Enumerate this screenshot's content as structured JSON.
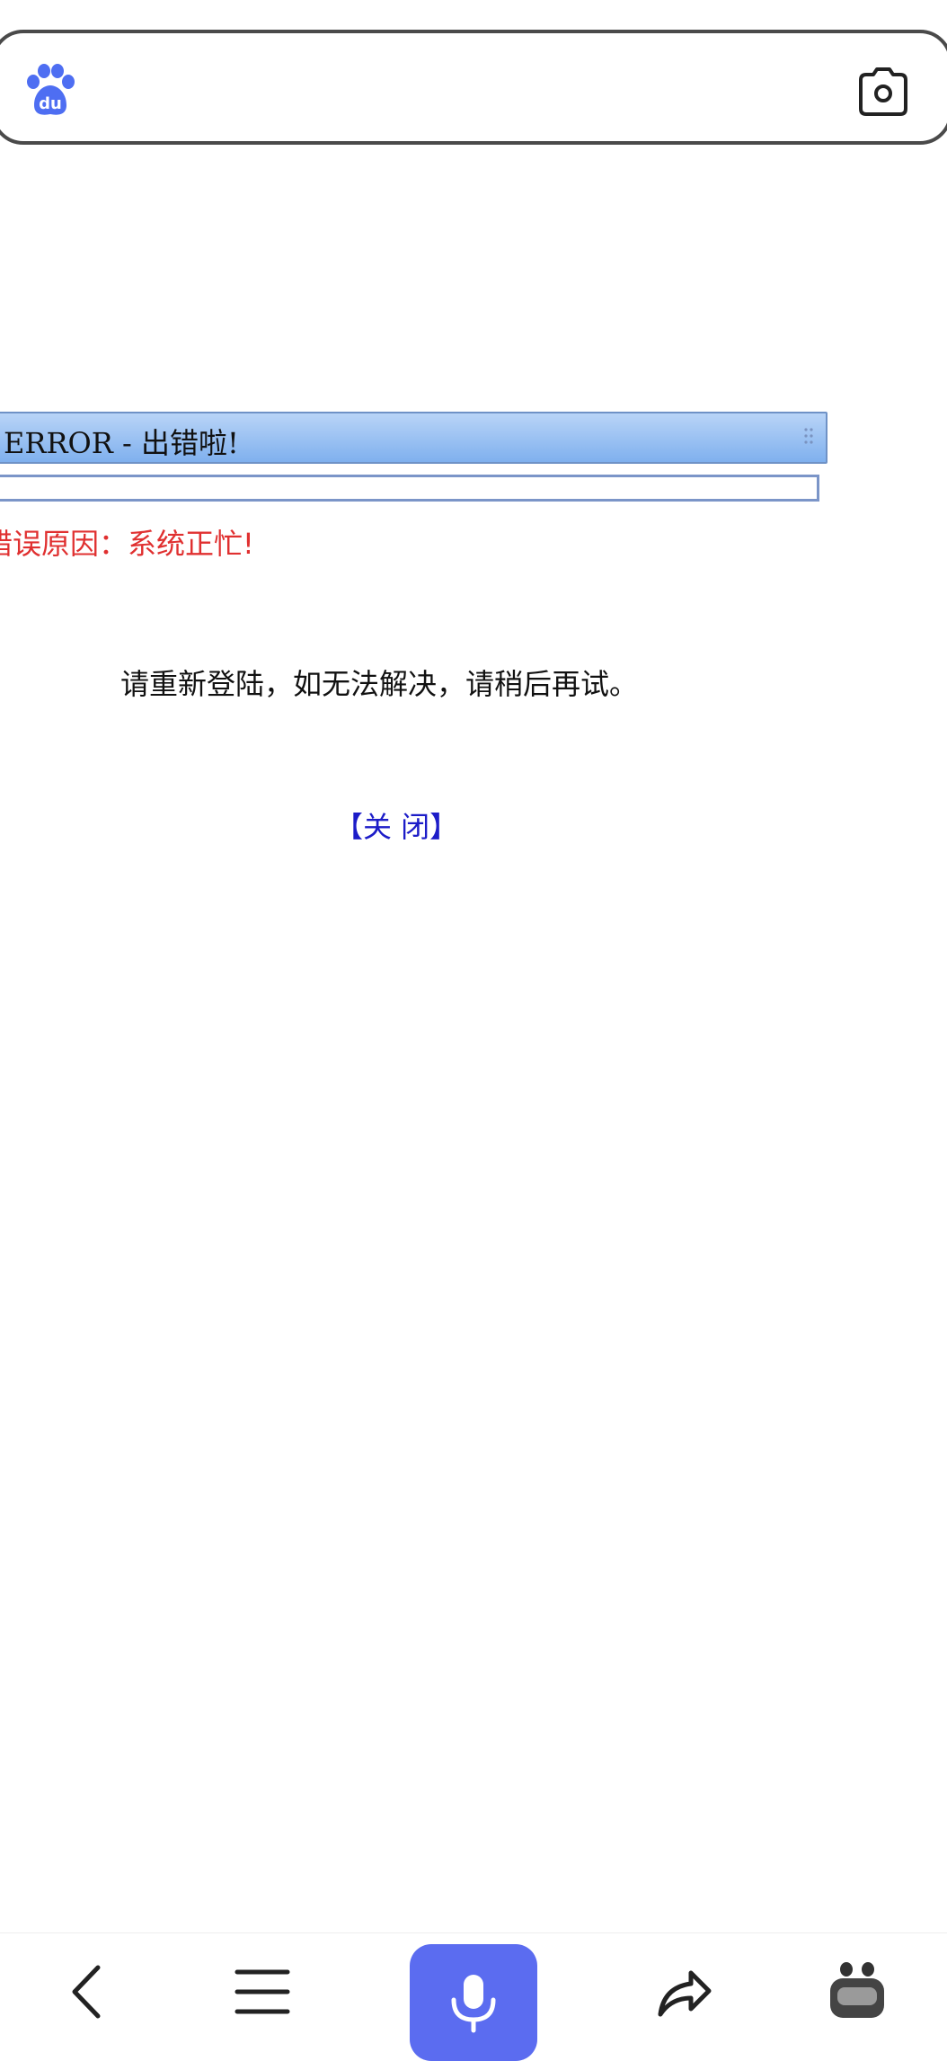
{
  "search_bar": {
    "logo_icon": "baidu-paw-icon",
    "camera_icon": "camera-icon"
  },
  "dialog": {
    "title": "ERROR - 出错啦!",
    "reason": "错误原因：系统正忙!",
    "message": "请重新登陆，如无法解决，请稍后再试。",
    "close_label": "【关 闭】"
  },
  "bottom_nav": {
    "items": [
      "back-icon",
      "menu-icon",
      "microphone-icon",
      "share-icon",
      "mascot-icon"
    ]
  },
  "colors": {
    "accent": "#5b6cf0",
    "error_text": "#e03030",
    "link": "#1c1cc8",
    "title_gradient_top": "#b9d4f7",
    "title_gradient_bottom": "#7fb0ee"
  }
}
